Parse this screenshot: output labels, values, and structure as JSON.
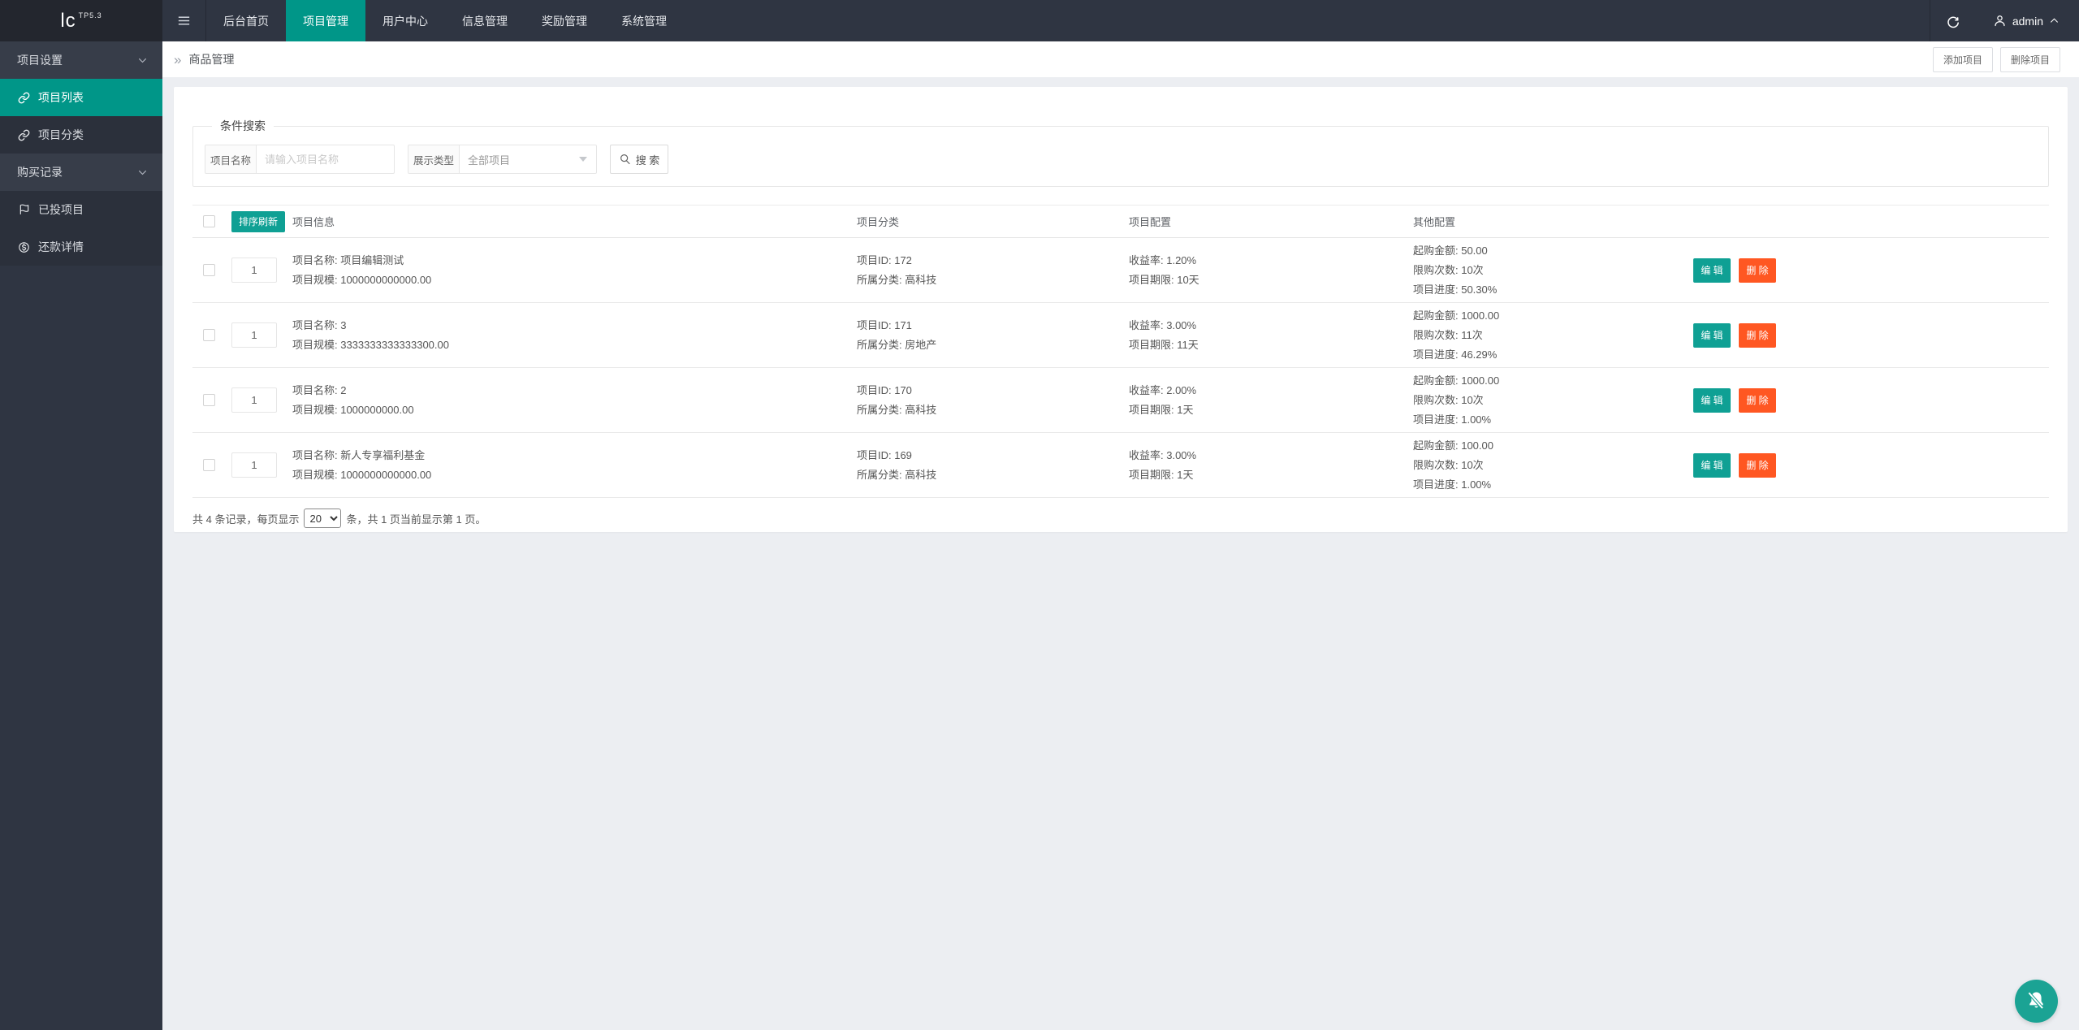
{
  "navbar": {
    "logo_text": "lc",
    "logo_sup": "TP5.3",
    "menu": [
      {
        "name": "backend-home",
        "label": "后台首页",
        "active": false
      },
      {
        "name": "project-management",
        "label": "项目管理",
        "active": true
      },
      {
        "name": "user-center",
        "label": "用户中心",
        "active": false
      },
      {
        "name": "info-management",
        "label": "信息管理",
        "active": false
      },
      {
        "name": "reward-management",
        "label": "奖励管理",
        "active": false
      },
      {
        "name": "system-management",
        "label": "系统管理",
        "active": false
      }
    ],
    "username": "admin"
  },
  "sidebar": {
    "items": [
      {
        "name": "project-settings",
        "label": "项目设置",
        "kind": "header",
        "icon": "chevron-down-icon",
        "active": false
      },
      {
        "name": "project-list",
        "label": "项目列表",
        "kind": "item",
        "icon": "link-icon",
        "active": true
      },
      {
        "name": "project-category",
        "label": "项目分类",
        "kind": "item",
        "icon": "link-icon",
        "active": false
      },
      {
        "name": "purchase-records",
        "label": "购买记录",
        "kind": "header",
        "icon": "chevron-down-icon",
        "active": false
      },
      {
        "name": "invested-projects",
        "label": "已投项目",
        "kind": "item",
        "icon": "flag-icon",
        "active": false
      },
      {
        "name": "repayment-details",
        "label": "还款详情",
        "kind": "item",
        "icon": "dollar-icon",
        "active": false
      }
    ]
  },
  "breadcrumb": {
    "marker": "»",
    "title": "商品管理"
  },
  "page_actions": [
    {
      "name": "add-project",
      "label": "添加项目"
    },
    {
      "name": "delete-project",
      "label": "删除项目"
    }
  ],
  "search": {
    "legend": "条件搜索",
    "name_label": "项目名称",
    "name_placeholder": "请输入项目名称",
    "type_label": "展示类型",
    "type_value": "全部项目",
    "search_button": "搜 索"
  },
  "table": {
    "sort_button": "排序刷新",
    "headers": [
      "项目信息",
      "项目分类",
      "项目配置",
      "其他配置"
    ],
    "edit_button": "编 辑",
    "delete_button": "删 除",
    "rows": [
      {
        "order": "1",
        "info": [
          "项目名称: 项目编辑测试",
          "项目规模: 1000000000000.00"
        ],
        "category": [
          "项目ID: 172",
          "所属分类: 高科技"
        ],
        "config": [
          "收益率: 1.20%",
          "项目期限: 10天"
        ],
        "other": [
          "起购金额: 50.00",
          "限购次数: 10次",
          "项目进度: 50.30%"
        ]
      },
      {
        "order": "1",
        "info": [
          "项目名称: 3",
          "项目规模: 3333333333333300.00"
        ],
        "category": [
          "项目ID: 171",
          "所属分类: 房地产"
        ],
        "config": [
          "收益率: 3.00%",
          "项目期限: 11天"
        ],
        "other": [
          "起购金额: 1000.00",
          "限购次数: 11次",
          "项目进度: 46.29%"
        ]
      },
      {
        "order": "1",
        "info": [
          "项目名称: 2",
          "项目规模: 1000000000.00"
        ],
        "category": [
          "项目ID: 170",
          "所属分类: 高科技"
        ],
        "config": [
          "收益率: 2.00%",
          "项目期限: 1天"
        ],
        "other": [
          "起购金额: 1000.00",
          "限购次数: 10次",
          "项目进度: 1.00%"
        ]
      },
      {
        "order": "1",
        "info": [
          "项目名称: 新人专享福利基金",
          "项目规模: 1000000000000.00"
        ],
        "category": [
          "项目ID: 169",
          "所属分类: 高科技"
        ],
        "config": [
          "收益率: 3.00%",
          "项目期限: 1天"
        ],
        "other": [
          "起购金额: 100.00",
          "限购次数: 10次",
          "项目进度: 1.00%"
        ]
      }
    ]
  },
  "pagination": {
    "prefix": "共 4 条记录，每页显示",
    "page_size": "20",
    "suffix": "条，共 1 页当前显示第 1 页。"
  },
  "icons": {
    "nav_toggle": "hamburger-icon",
    "refresh": "refresh-icon",
    "user": "user-icon",
    "user_caret": "chevron-up-icon",
    "search": "magnifier-icon",
    "floating": "bell-slash-icon"
  },
  "colors": {
    "navbar_bg": "#2F3542",
    "logo_bg": "#23262E",
    "accent_teal": "#009688",
    "button_teal": "#0FA094",
    "danger_orange": "#FF5722",
    "page_bg": "#ECEEF2"
  }
}
